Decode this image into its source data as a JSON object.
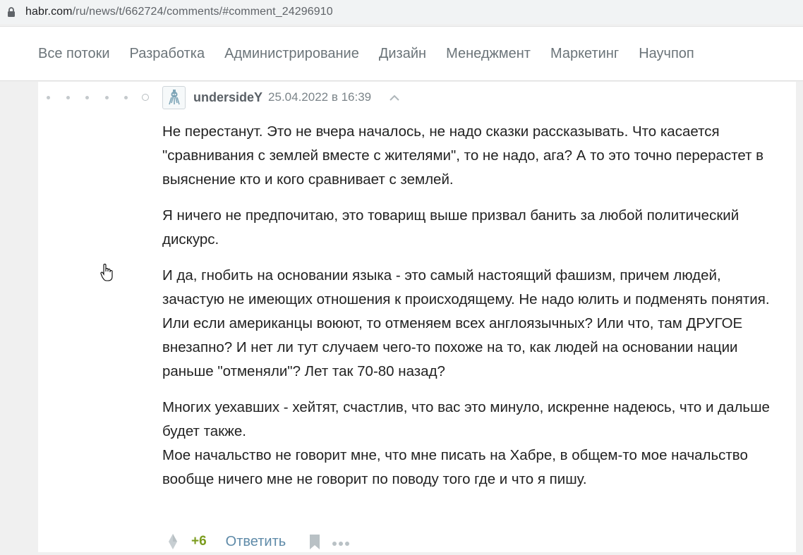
{
  "browser": {
    "url_host": "habr.com",
    "url_path": "/ru/news/t/662724/comments/#comment_24296910",
    "lock_icon": "lock-icon"
  },
  "nav": {
    "items": [
      {
        "label": "Все потоки"
      },
      {
        "label": "Разработка"
      },
      {
        "label": "Администрирование"
      },
      {
        "label": "Дизайн"
      },
      {
        "label": "Менеджмент"
      },
      {
        "label": "Маркетинг"
      },
      {
        "label": "Научпоп"
      }
    ]
  },
  "comment": {
    "author": "undersideY",
    "timestamp": "25.04.2022 в 16:39",
    "paragraphs": [
      "Не перестанут. Это не вчера началось, не надо сказки рассказывать. Что касается \"сравнивания с землей вместе с жителями\", то не надо, ага? А то это точно перерастет в выяснение кто и кого сравнивает с землей.",
      "Я ничего не предпочитаю, это товарищ выше призвал банить за любой политический дискурс.",
      "И да, гнобить на основании языка - это самый настоящий фашизм, причем людей, зачастую не имеющих отношения к происходящему. Не надо юлить и подменять понятия. Или если американцы воюют, то отменяем всех англоязычных? Или что, там ДРУГОЕ внезапно? И нет ли тут случаем чего-то похоже на то, как людей на основании нации раньше \"отменяли\"? Лет так 70-80 назад?",
      "Многих уехавших - хейтят, счастлив, что вас это минуло, искренне надеюсь, что и дальше будет также.",
      "Мое начальство не говорит мне, что мне писать на Хабре, в общем-то мое начальство вообще ничего мне не говорит по поводу того где и что я пишу."
    ],
    "score": "+6",
    "reply_label": "Ответить"
  },
  "colors": {
    "score_positive": "#7b9c1e",
    "link": "#5e8aa8",
    "nav_text": "#6b7479"
  }
}
